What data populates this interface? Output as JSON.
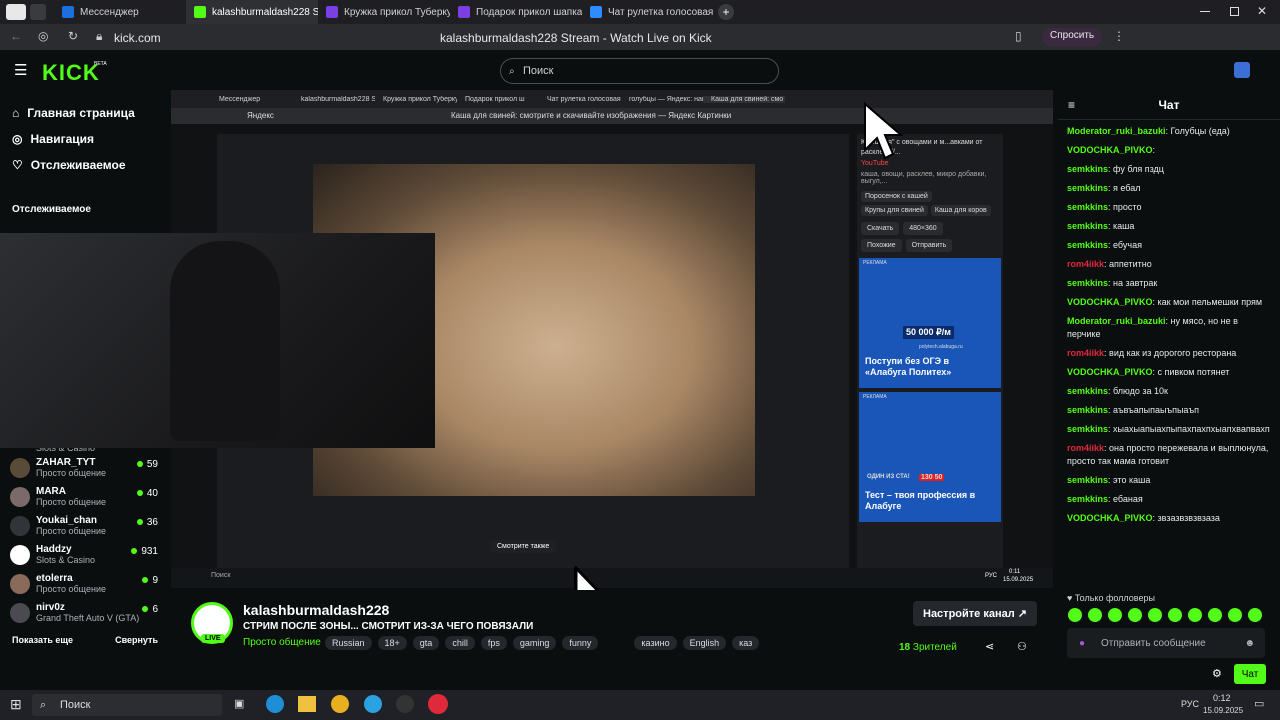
{
  "browser": {
    "tabs": [
      {
        "label": "Мессенджер",
        "color": "#1d6fe0"
      },
      {
        "label": "kalashburmaldash228 S",
        "color": "#53fc18"
      },
      {
        "label": "Кружка прикол Туберкуле",
        "color": "#7b3fe4"
      },
      {
        "label": "Подарок прикол шапка-н",
        "color": "#7b3fe4"
      },
      {
        "label": "Чат рулетка голосовая —",
        "color": "#2d8cff"
      }
    ],
    "url": "kick.com",
    "page_title": "kalashburmaldash228 Stream - Watch Live on Kick",
    "ask_button": "Спросить"
  },
  "header": {
    "logo": "KICK",
    "beta": "BETA",
    "search_placeholder": "Поиск"
  },
  "sidebar": {
    "nav": [
      {
        "label": "Главная страница",
        "icon": "home-icon"
      },
      {
        "label": "Навигация",
        "icon": "compass-icon"
      },
      {
        "label": "Отслеживаемое",
        "icon": "heart-icon"
      }
    ],
    "section_title": "Отслеживаемое",
    "following": [
      {
        "name": "",
        "category": "Slots & Casino",
        "viewers": ""
      },
      {
        "name": "ZAHAR_TYT",
        "category": "Просто общение",
        "viewers": "59"
      },
      {
        "name": "MARA",
        "category": "Просто общение",
        "viewers": "40"
      },
      {
        "name": "Youkai_chan",
        "category": "Просто общение",
        "viewers": "36"
      },
      {
        "name": "Haddzy",
        "category": "Slots & Casino",
        "viewers": "931"
      },
      {
        "name": "etolerra",
        "category": "Просто общение",
        "viewers": "9"
      },
      {
        "name": "nirv0z",
        "category": "Grand Theft Auto V (GTA)",
        "viewers": "6"
      }
    ],
    "show_more": "Показать еще",
    "collapse": "Свернуть"
  },
  "player": {
    "inner_tabs": [
      "Мессенджер",
      "kalashburmaldash228 St",
      "Кружка прикол Туберку",
      "Подарок прикол ш",
      "Чат рулетка голосовая",
      "голубцы — Яндекс: нашл",
      "Каша для свиней: смо"
    ],
    "inner_address": "Яндекс",
    "inner_title": "Каша для свиней: смотрите и скачивайте изображения — Яндекс Картинки",
    "related_caption": "Ка...шная\" с овощами и м...авками от расклева//...",
    "related_source": "YouTube",
    "related_desc": "каша, овощи, расклев, микро добавки, выгул,...",
    "chips": [
      "Поросенок с кашей",
      "Крупы для свиней",
      "Каша для коров"
    ],
    "download": "Скачать",
    "size": "480×360",
    "similar": "Похожие",
    "share": "Отправить",
    "ad1_label": "РЕКЛАМА",
    "ad1_title": "Поступи без ОГЭ в «Алабуга Политех»",
    "ad1_site": "polytech.alabuga.ru",
    "ad1_price": "50 000 ₽/м",
    "ad2_label": "РЕКЛАМА",
    "ad2_title": "Тест – твоя профессия в Алабуге",
    "ad2_price": "130 50",
    "ad2_banner": "ОДИН ИЗ СТА!",
    "see_also": "Смотрите также",
    "inner_search": "Поиск",
    "inner_lang": "РУС",
    "inner_time": "0:11",
    "inner_date": "15.09.2025"
  },
  "stream": {
    "channel": "kalashburmaldash228",
    "title": "СТРИМ ПОСЛЕ ЗОНЫ... СМОТРИТ ИЗ-ЗА ЧЕГО ПОВЯЗАЛИ",
    "category": "Просто общение",
    "live": "LIVE",
    "tags": [
      "Russian",
      "18+",
      "gta",
      "chill",
      "fps",
      "gaming",
      "funny",
      "казино",
      "English",
      "каз"
    ],
    "setup_button": "Настройте канал",
    "viewers": "18",
    "viewers_label": "Зрителей"
  },
  "chat": {
    "title": "Чат",
    "messages": [
      {
        "user": "Moderator_ruki_bazuki",
        "text": ": Голубцы (еда)",
        "color": "#53fc18"
      },
      {
        "user": "VODOCHKA_PIVKO",
        "text": ":",
        "color": "#53fc18"
      },
      {
        "user": "semkkins",
        "text": ": фу бля пздц",
        "color": "#53fc18"
      },
      {
        "user": "semkkins",
        "text": ": я ебал",
        "color": "#53fc18"
      },
      {
        "user": "semkkins",
        "text": ": просто",
        "color": "#53fc18"
      },
      {
        "user": "semkkins",
        "text": ": каша",
        "color": "#53fc18"
      },
      {
        "user": "semkkins",
        "text": ": ебучая",
        "color": "#53fc18"
      },
      {
        "user": "rom4iikk",
        "text": ": аппетитно",
        "color": "#e0293b"
      },
      {
        "user": "semkkins",
        "text": ": на завтрак",
        "color": "#53fc18"
      },
      {
        "user": "VODOCHKA_PIVKO",
        "text": ": как мои пельмешки прям",
        "color": "#53fc18"
      },
      {
        "user": "Moderator_ruki_bazuki",
        "text": ": ну мясо, но не в перчике",
        "color": "#53fc18"
      },
      {
        "user": "rom4iikk",
        "text": ": вид как из дорогого ресторана",
        "color": "#e0293b"
      },
      {
        "user": "VODOCHKA_PIVKO",
        "text": ": с пивком потянет",
        "color": "#53fc18"
      },
      {
        "user": "semkkins",
        "text": ": блюдо за 10к",
        "color": "#53fc18"
      },
      {
        "user": "semkkins",
        "text": ": аъвъапыпаыъпыаъп",
        "color": "#53fc18"
      },
      {
        "user": "semkkins",
        "text": ": хыахыапыахпыпахпахпхыапхвапвахп",
        "color": "#53fc18"
      },
      {
        "user": "rom4iikk",
        "text": ": она просто пережевала и выплюнула, просто так мама готовит",
        "color": "#e0293b"
      },
      {
        "user": "semkkins",
        "text": ": это каша",
        "color": "#53fc18"
      },
      {
        "user": "semkkins",
        "text": ": ебаная",
        "color": "#53fc18"
      },
      {
        "user": "VODOCHKA_PIVKO",
        "text": ": звзазвзвзвзаза",
        "color": "#53fc18"
      }
    ],
    "followers_only": "Только фолловеры",
    "input_placeholder": "Отправить сообщение",
    "send_button": "Чат"
  },
  "taskbar": {
    "search": "Поиск",
    "lang": "РУС",
    "time": "0:12",
    "date": "15.09.2025"
  }
}
